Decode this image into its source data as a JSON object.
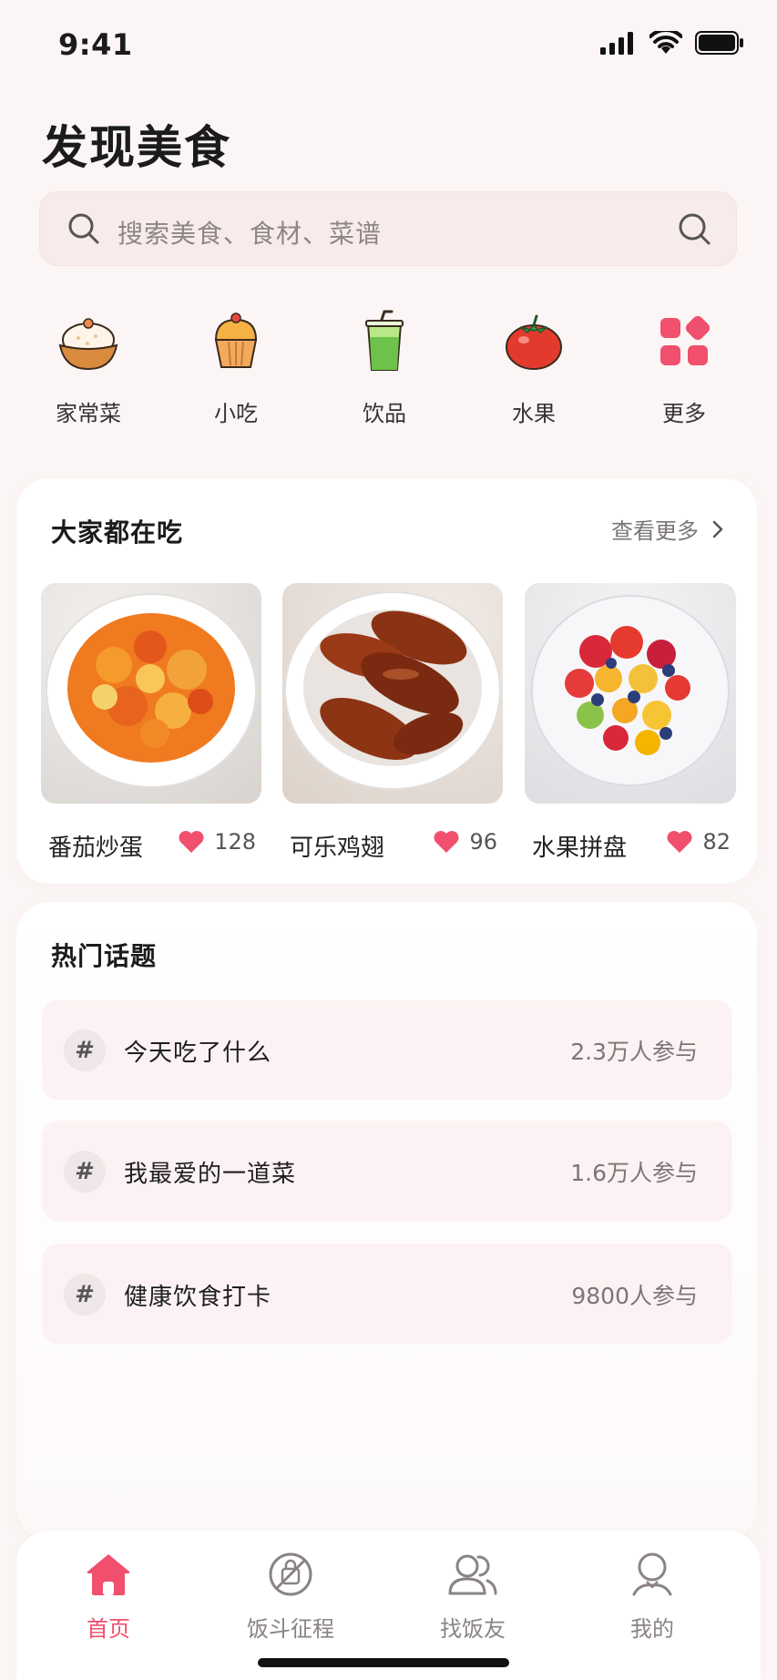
{
  "status_bar": {
    "time": "9:41"
  },
  "page": {
    "title": "发现美食"
  },
  "search": {
    "placeholder": "搜索美食、食材、菜谱"
  },
  "categories": [
    {
      "label": "家常菜",
      "icon": "rice-bowl-icon"
    },
    {
      "label": "小吃",
      "icon": "cupcake-icon"
    },
    {
      "label": "饮品",
      "icon": "drink-icon"
    },
    {
      "label": "水果",
      "icon": "tomato-icon"
    },
    {
      "label": "更多",
      "icon": "grid-more-icon"
    }
  ],
  "everyone_eating": {
    "title": "大家都在吃",
    "see_more": "查看更多",
    "items": [
      {
        "name": "番茄炒蛋",
        "likes": "128"
      },
      {
        "name": "可乐鸡翅",
        "likes": "96"
      },
      {
        "name": "水果拼盘",
        "likes": "82"
      }
    ]
  },
  "hot_topics": {
    "title": "热门话题",
    "hash": "#",
    "items": [
      {
        "label": "今天吃了什么",
        "count": "2.3万人参与"
      },
      {
        "label": "我最爱的一道菜",
        "count": "1.6万人参与"
      },
      {
        "label": "健康饮食打卡",
        "count": "9800人参与"
      }
    ]
  },
  "tab_bar": {
    "items": [
      {
        "label": "首页",
        "icon": "home-icon",
        "active": true
      },
      {
        "label": "饭斗征程",
        "icon": "journey-icon",
        "active": false
      },
      {
        "label": "找饭友",
        "icon": "friends-icon",
        "active": false
      },
      {
        "label": "我的",
        "icon": "profile-icon",
        "active": false
      }
    ]
  },
  "colors": {
    "accent": "#f0506e",
    "search_bg": "#f8ebec",
    "topic_bg": "#fdf2f3"
  }
}
